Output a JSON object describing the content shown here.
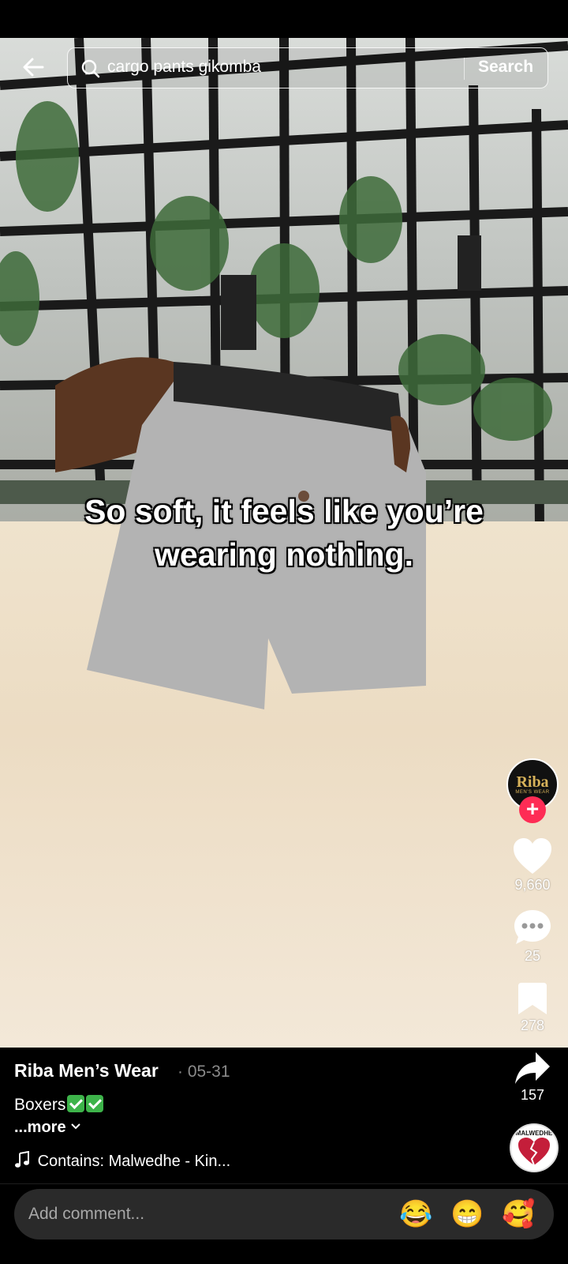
{
  "search": {
    "query": "cargo pants gikomba",
    "button_label": "Search"
  },
  "video": {
    "caption_line1": "So soft, it feels like you’re",
    "caption_line2": "wearing nothing."
  },
  "creator": {
    "avatar_brand": "Riba",
    "avatar_sub": "MEN'S WEAR",
    "follow_symbol": "+"
  },
  "actions": {
    "likes": "9,660",
    "comments": "25",
    "saves": "278",
    "shares": "157"
  },
  "post": {
    "author": "Riba Men’s Wear",
    "date": "· 05-31",
    "description": "Boxers",
    "more_label": "...more",
    "music": "Contains: Malwedhe - Kin...",
    "music_disc_label": "MALWEDHE"
  },
  "comment": {
    "placeholder": "Add comment...",
    "emojis": [
      "😂",
      "😁",
      "🥰"
    ]
  },
  "colors": {
    "follow": "#fe2c55",
    "background": "#000000",
    "comment_bar": "#2a2a2a"
  }
}
